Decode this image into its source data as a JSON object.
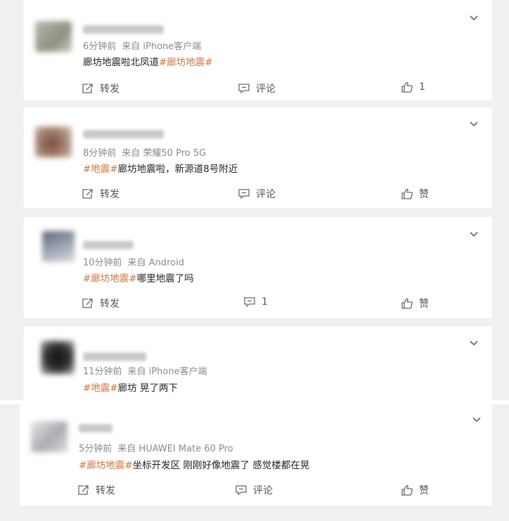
{
  "posts": [
    {
      "time": "6分钟前",
      "source": "来自 iPhone客户端",
      "text_before": "廊坊地震啦北凤道",
      "tag": "#廊坊地震#",
      "text_after": "",
      "repost_label": "转发",
      "comment_label": "评论",
      "like_label": "1"
    },
    {
      "time": "8分钟前",
      "source": "来自 荣耀50 Pro 5G",
      "text_before": "",
      "tag": "#地震#",
      "text_after": "廊坊地震啦，新源道8号附近",
      "repost_label": "转发",
      "comment_label": "评论",
      "like_label": "赞"
    },
    {
      "time": "10分钟前",
      "source": "来自 Android",
      "text_before": "",
      "tag": "#廊坊地震#",
      "text_after": "哪里地震了吗",
      "repost_label": "转发",
      "comment_label": "1",
      "like_label": "赞"
    },
    {
      "time": "11分钟前",
      "source": "来自 iPhone客户端",
      "text_before": "",
      "tag": "#地震#",
      "text_after": "廊坊 晃了两下",
      "repost_label": "",
      "comment_label": "",
      "like_label": ""
    },
    {
      "time": "5分钟前",
      "source": "来自 HUAWEI Mate 60 Pro",
      "text_before": "",
      "tag": "#廊坊地震#",
      "text_after": "坐标开发区 刚刚好像地震了 感觉楼都在晃",
      "repost_label": "转发",
      "comment_label": "评论",
      "like_label": "赞"
    }
  ],
  "colors": {
    "background": "#f0f1f3",
    "card": "#ffffff",
    "tag": "#e2713a",
    "meta": "#8a8a8a"
  },
  "icons": {
    "menu": "chevron-down-icon",
    "repost": "share-icon",
    "comment": "comment-icon",
    "like": "thumbs-up-icon"
  }
}
